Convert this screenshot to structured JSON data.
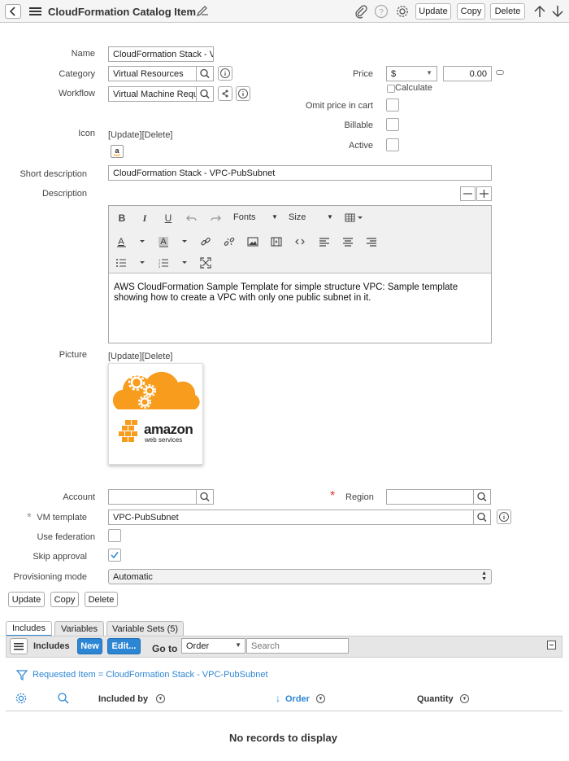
{
  "header": {
    "title": "CloudFormation Catalog Item",
    "buttons": {
      "update": "Update",
      "copy": "Copy",
      "delete": "Delete"
    }
  },
  "form": {
    "name": {
      "label": "Name",
      "value": "CloudFormation Stack - V"
    },
    "category": {
      "label": "Category",
      "value": "Virtual Resources"
    },
    "workflow": {
      "label": "Workflow",
      "value": "Virtual Machine Requ"
    },
    "price": {
      "label": "Price",
      "currency": "$",
      "amount": "0.00",
      "calculate_label": "Calculate"
    },
    "omit_price": {
      "label": "Omit price in cart"
    },
    "billable": {
      "label": "Billable"
    },
    "active": {
      "label": "Active"
    },
    "icon": {
      "label": "Icon",
      "links": "[Update][Delete]"
    },
    "short_description": {
      "label": "Short description",
      "value": "CloudFormation Stack - VPC-PubSubnet"
    },
    "description": {
      "label": "Description",
      "fonts": "Fonts",
      "size": "Size",
      "text": "AWS CloudFormation Sample Template for simple structure VPC: Sample template showing how to create a VPC with only one public subnet in it."
    },
    "picture": {
      "label": "Picture",
      "links": "[Update][Delete]",
      "brand_line1": "amazon",
      "brand_line2": "web services"
    },
    "account": {
      "label": "Account",
      "value": ""
    },
    "region": {
      "label": "Region",
      "value": ""
    },
    "vm_template": {
      "label": "VM template",
      "value": "VPC-PubSubnet"
    },
    "use_federation": {
      "label": "Use federation",
      "checked": false
    },
    "skip_approval": {
      "label": "Skip approval",
      "checked": true
    },
    "provisioning_mode": {
      "label": "Provisioning mode",
      "value": "Automatic"
    }
  },
  "bottom_buttons": {
    "update": "Update",
    "copy": "Copy",
    "delete": "Delete"
  },
  "tabs": [
    {
      "label": "Includes"
    },
    {
      "label": "Variables"
    },
    {
      "label": "Variable Sets (5)"
    }
  ],
  "related_list": {
    "title": "Includes",
    "new_label": "New",
    "edit_label": "Edit...",
    "goto_label": "Go to",
    "goto_select": "Order",
    "search_placeholder": "Search",
    "filter_text": "Requested Item = CloudFormation Stack - VPC-PubSubnet",
    "columns": [
      "Included by",
      "Order",
      "Quantity"
    ],
    "empty_message": "No records to display"
  },
  "colors": {
    "accent": "#2d86d3",
    "required": "#e0332d",
    "aws_orange": "#f79c1c"
  }
}
